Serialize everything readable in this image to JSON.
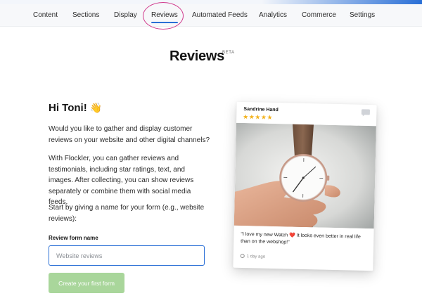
{
  "nav": {
    "tabs": [
      {
        "label": "Content"
      },
      {
        "label": "Sections"
      },
      {
        "label": "Display"
      },
      {
        "label": "Reviews",
        "active": true
      },
      {
        "label": "Automated Feeds"
      },
      {
        "label": "Analytics"
      },
      {
        "label": "Commerce"
      },
      {
        "label": "Settings"
      }
    ]
  },
  "header": {
    "title": "Reviews",
    "badge": "BETA"
  },
  "intro": {
    "greeting": "Hi Toni!",
    "greeting_emoji": "👋",
    "paragraph1": "Would you like to gather and display customer reviews on your website and other digital channels?",
    "paragraph2": "With Flockler, you can gather reviews and testimonials, including star ratings, text, and images. After collecting, you can show reviews separately or combine them with social media feeds.",
    "paragraph3": "Start by giving a name for your form (e.g., website reviews):"
  },
  "form": {
    "label": "Review form name",
    "placeholder": "Website reviews",
    "value": "",
    "button_label": "Create your first form"
  },
  "preview_card": {
    "reviewer": "Sandrine Hand",
    "rating": 5,
    "stars": "★★★★★",
    "text": "\"I love my new Watch ❤️ It looks even better in real life than on the webshop!\"",
    "timestamp": "1 day ago",
    "icons": {
      "comment": "chat-bubble-icon",
      "time": "clock-icon"
    }
  },
  "colors": {
    "accent": "#2a6fd6",
    "highlight_ring": "#d13a8c",
    "button_disabled": "#a9d69b",
    "star": "#f3b21b"
  }
}
